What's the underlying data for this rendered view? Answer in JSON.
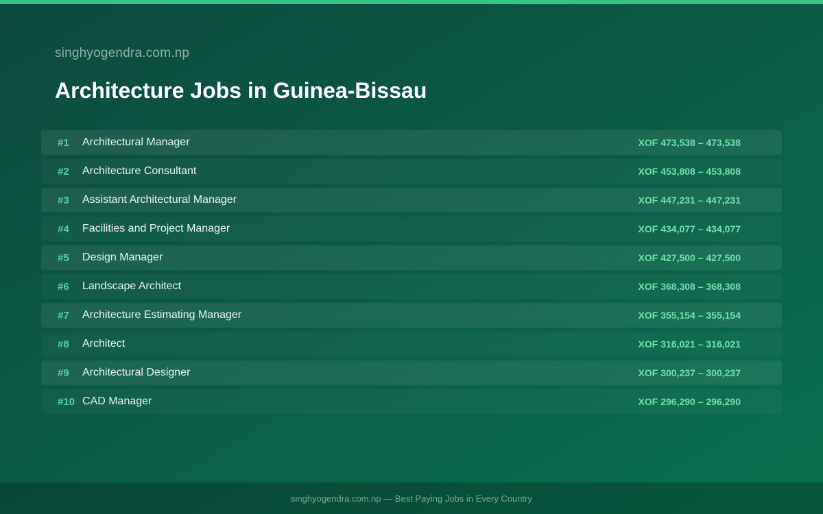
{
  "header": {
    "site_name": "singhyogendra.com.np",
    "title": "Architecture Jobs in Guinea-Bissau"
  },
  "jobs": [
    {
      "rank": "#1",
      "title": "Architectural Manager",
      "salary": "XOF 473,538 – 473,538"
    },
    {
      "rank": "#2",
      "title": "Architecture Consultant",
      "salary": "XOF 453,808 – 453,808"
    },
    {
      "rank": "#3",
      "title": "Assistant Architectural Manager",
      "salary": "XOF 447,231 – 447,231"
    },
    {
      "rank": "#4",
      "title": "Facilities and Project Manager",
      "salary": "XOF 434,077 – 434,077"
    },
    {
      "rank": "#5",
      "title": "Design Manager",
      "salary": "XOF 427,500 – 427,500"
    },
    {
      "rank": "#6",
      "title": "Landscape Architect",
      "salary": "XOF 368,308 – 368,308"
    },
    {
      "rank": "#7",
      "title": "Architecture Estimating Manager",
      "salary": "XOF 355,154 – 355,154"
    },
    {
      "rank": "#8",
      "title": "Architect",
      "salary": "XOF 316,021 – 316,021"
    },
    {
      "rank": "#9",
      "title": "Architectural Designer",
      "salary": "XOF 300,237 – 300,237"
    },
    {
      "rank": "#10",
      "title": "CAD Manager",
      "salary": "XOF 296,290 – 296,290"
    }
  ],
  "footer": {
    "text": "singhyogendra.com.np — Best Paying Jobs in Every Country"
  },
  "colors": {
    "accent": "#34c487",
    "rank": "#4fd69b",
    "salary": "#6ee3ad",
    "background": "#0b5a45"
  }
}
